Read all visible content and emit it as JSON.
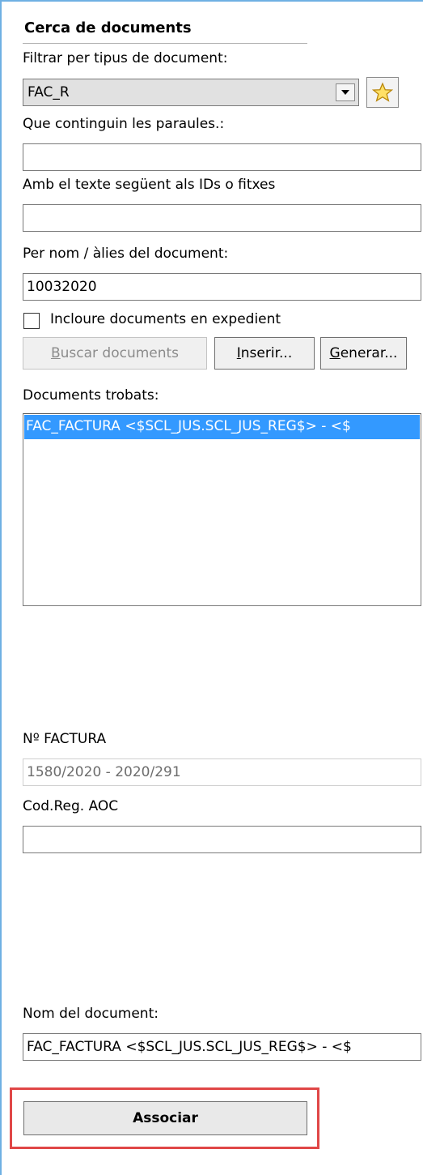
{
  "panel": {
    "title": "Cerca de documents"
  },
  "filter": {
    "label": "Filtrar per tipus de document:",
    "selected": "FAC_R"
  },
  "words": {
    "label": "Que continguin les paraules.:",
    "value": ""
  },
  "ids": {
    "label": "Amb el texte següent als IDs o fitxes",
    "value": ""
  },
  "alias": {
    "label": "Per nom / àlies del document:",
    "value": "10032020"
  },
  "include": {
    "label": "Incloure documents en expedient",
    "checked": false
  },
  "buttons": {
    "search": {
      "mnemonic": "B",
      "rest": "uscar documents"
    },
    "insert": {
      "mnemonic": "I",
      "rest": "nserir..."
    },
    "generate": {
      "mnemonic": "G",
      "rest": "enerar..."
    }
  },
  "results": {
    "label": "Documents trobats:",
    "items": [
      "FAC_FACTURA <$SCL_JUS.SCL_JUS_REG$> - <$"
    ]
  },
  "invoice_number": {
    "label": "Nº FACTURA",
    "value": "1580/2020 - 2020/291"
  },
  "aoc_code": {
    "label": "Cod.Reg. AOC",
    "value": ""
  },
  "doc_name": {
    "label": "Nom del document:",
    "value": "FAC_FACTURA <$SCL_JUS.SCL_JUS_REG$> - <$"
  },
  "associate": {
    "label": "Associar"
  },
  "colors": {
    "selection": "#3399ff",
    "highlight_border": "#e04747",
    "frame": "#6fb0e3"
  },
  "icons": {
    "combo_button": "chevron-down-icon",
    "favorite": "star-icon"
  }
}
